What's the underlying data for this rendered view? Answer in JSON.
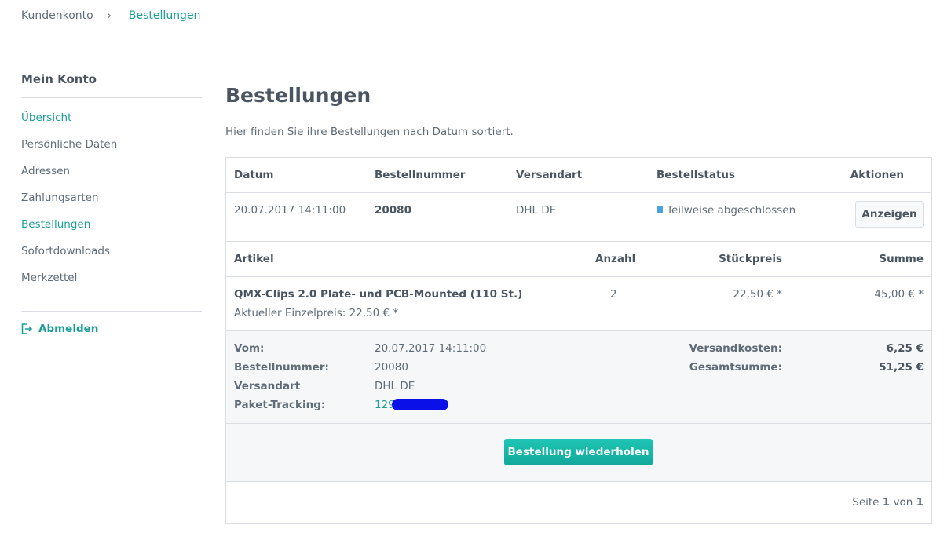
{
  "breadcrumb": {
    "items": [
      "Kundenkonto",
      "Bestellungen"
    ],
    "separator": "›"
  },
  "sidebar": {
    "title": "Mein Konto",
    "items": [
      {
        "label": "Übersicht",
        "active": false
      },
      {
        "label": "Persönliche Daten",
        "active": false
      },
      {
        "label": "Adressen",
        "active": false
      },
      {
        "label": "Zahlungsarten",
        "active": false
      },
      {
        "label": "Bestellungen",
        "active": true
      },
      {
        "label": "Sofortdownloads",
        "active": false
      },
      {
        "label": "Merkzettel",
        "active": false
      }
    ],
    "logout": "Abmelden"
  },
  "main": {
    "title": "Bestellungen",
    "intro": "Hier finden Sie ihre Bestellungen nach Datum sortiert."
  },
  "orders_table": {
    "headers": {
      "date": "Datum",
      "number": "Bestellnummer",
      "shipping": "Versandart",
      "status": "Bestellstatus",
      "actions": "Aktionen"
    },
    "order": {
      "date": "20.07.2017 14:11:00",
      "number": "20080",
      "shipping": "DHL DE",
      "status": "Teilweise abgeschlossen",
      "status_color": "#4aa3df",
      "show_button": "Anzeigen"
    }
  },
  "articles": {
    "headers": {
      "article": "Artikel",
      "quantity": "Anzahl",
      "unit_price": "Stückpreis",
      "total": "Summe"
    },
    "items": [
      {
        "name": "QMX-Clips 2.0 Plate- und PCB-Mounted (110 St.)",
        "current_price": "Aktueller Einzelpreis: 22,50 € *",
        "quantity": "2",
        "unit_price": "22,50 € *",
        "total": "45,00 € *"
      }
    ]
  },
  "details": {
    "labels": {
      "from": "Vom:",
      "number": "Bestellnummer:",
      "shipping": "Versandart",
      "tracking": "Paket-Tracking:"
    },
    "values": {
      "from": "20.07.2017 14:11:00",
      "number": "20080",
      "shipping": "DHL DE",
      "tracking": "129"
    },
    "totals": {
      "shipping_label": "Versandkosten:",
      "shipping_value": "6,25 €",
      "sum_label": "Gesamtsumme:",
      "sum_value": "51,25 €"
    }
  },
  "repeat_button": "Bestellung wiederholen",
  "pagination": {
    "prefix": "Seite",
    "current": "1",
    "of": "von",
    "total": "1"
  },
  "colors": {
    "accent": "#1a9e96",
    "button": "#1fc5b5",
    "status": "#4aa3df"
  }
}
